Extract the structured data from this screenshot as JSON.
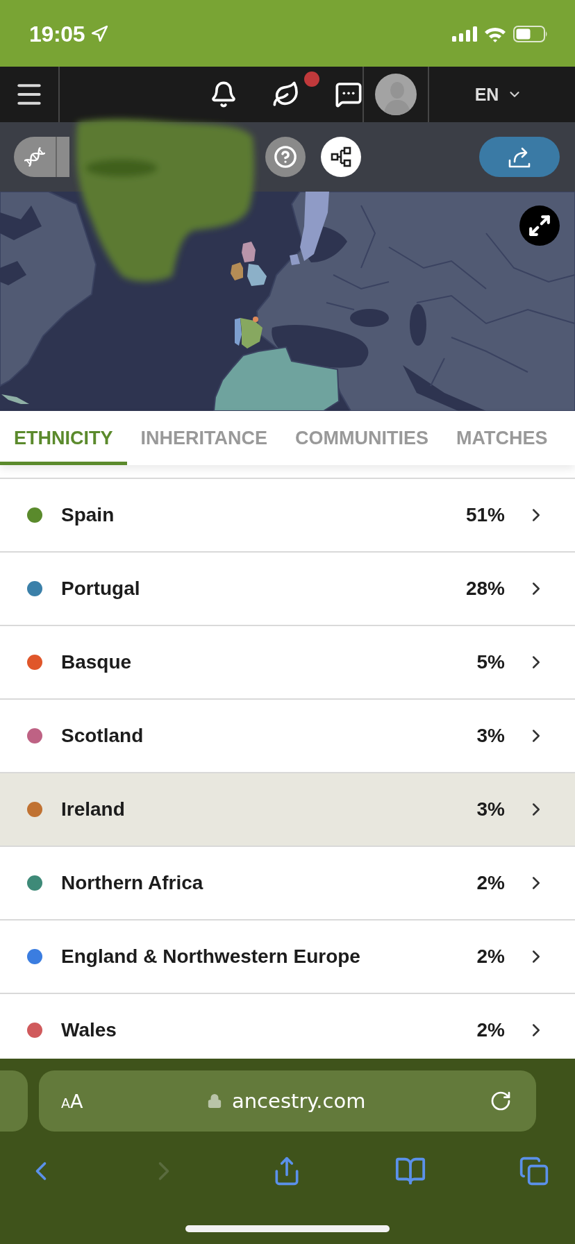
{
  "status_bar": {
    "time": "19:05"
  },
  "top_nav": {
    "has_new_messages": true,
    "language": "EN"
  },
  "tabs": [
    {
      "label": "ETHNICITY",
      "selected": true
    },
    {
      "label": "INHERITANCE",
      "selected": false
    },
    {
      "label": "COMMUNITIES",
      "selected": false
    },
    {
      "label": "MATCHES",
      "selected": false
    }
  ],
  "regions": [
    {
      "name": "Spain",
      "percent": "51%",
      "color": "#5a8a2c",
      "selected": false
    },
    {
      "name": "Portugal",
      "percent": "28%",
      "color": "#3b80a9",
      "selected": false
    },
    {
      "name": "Basque",
      "percent": "5%",
      "color": "#e0562a",
      "selected": false
    },
    {
      "name": "Scotland",
      "percent": "3%",
      "color": "#be6284",
      "selected": false
    },
    {
      "name": "Ireland",
      "percent": "3%",
      "color": "#c07232",
      "selected": true
    },
    {
      "name": "Northern Africa",
      "percent": "2%",
      "color": "#3e8a78",
      "selected": false
    },
    {
      "name": "England & Northwestern Europe",
      "percent": "2%",
      "color": "#3b7de0",
      "selected": false
    },
    {
      "name": "Wales",
      "percent": "2%",
      "color": "#d05a5c",
      "selected": false
    }
  ],
  "browser": {
    "text_size_button": "AA",
    "url": "ancestry.com",
    "back_disabled": false,
    "forward_disabled": true
  }
}
